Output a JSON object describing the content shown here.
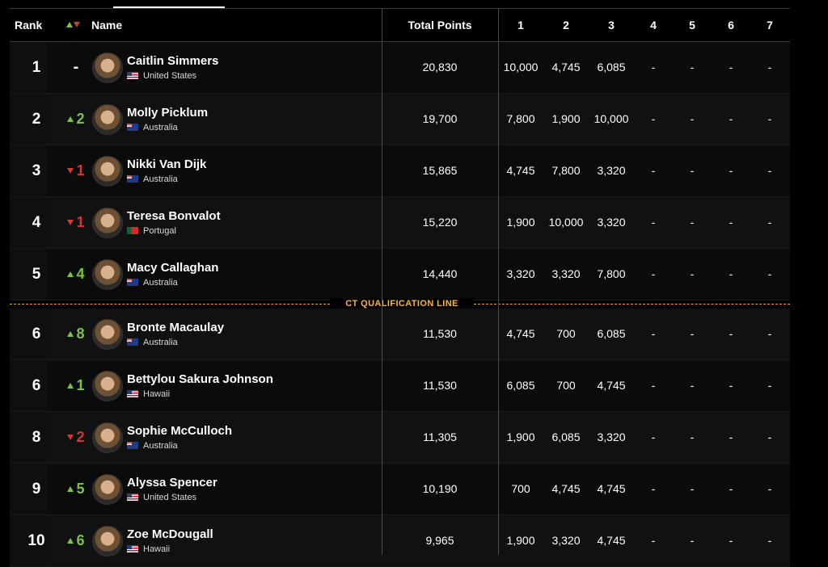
{
  "header": {
    "rank": "Rank",
    "name": "Name",
    "total": "Total Points",
    "events": [
      "1",
      "2",
      "3",
      "4",
      "5",
      "6",
      "7"
    ]
  },
  "qualification_line": "CT QUALIFICATION LINE",
  "colors": {
    "up": "#7fc241",
    "down": "#cf3a32",
    "qualification": "#f3b73e"
  },
  "rows": [
    {
      "rank": "1",
      "move": "-",
      "dir": "none",
      "name": "Caitlin Simmers",
      "country": "United States",
      "flag": "us",
      "total": "20,830",
      "events": [
        "10,000",
        "4,745",
        "6,085",
        "-",
        "-",
        "-",
        "-"
      ]
    },
    {
      "rank": "2",
      "move": "2",
      "dir": "up",
      "name": "Molly Picklum",
      "country": "Australia",
      "flag": "au",
      "total": "19,700",
      "events": [
        "7,800",
        "1,900",
        "10,000",
        "-",
        "-",
        "-",
        "-"
      ]
    },
    {
      "rank": "3",
      "move": "1",
      "dir": "down",
      "name": "Nikki Van Dijk",
      "country": "Australia",
      "flag": "au",
      "total": "15,865",
      "events": [
        "4,745",
        "7,800",
        "3,320",
        "-",
        "-",
        "-",
        "-"
      ]
    },
    {
      "rank": "4",
      "move": "1",
      "dir": "down",
      "name": "Teresa Bonvalot",
      "country": "Portugal",
      "flag": "pt",
      "total": "15,220",
      "events": [
        "1,900",
        "10,000",
        "3,320",
        "-",
        "-",
        "-",
        "-"
      ]
    },
    {
      "rank": "5",
      "move": "4",
      "dir": "up",
      "name": "Macy Callaghan",
      "country": "Australia",
      "flag": "au",
      "total": "14,440",
      "events": [
        "3,320",
        "3,320",
        "7,800",
        "-",
        "-",
        "-",
        "-"
      ]
    },
    {
      "rank": "6",
      "move": "8",
      "dir": "up",
      "name": "Bronte Macaulay",
      "country": "Australia",
      "flag": "au",
      "total": "11,530",
      "events": [
        "4,745",
        "700",
        "6,085",
        "-",
        "-",
        "-",
        "-"
      ]
    },
    {
      "rank": "6",
      "move": "1",
      "dir": "up",
      "name": "Bettylou Sakura Johnson",
      "country": "Hawaii",
      "flag": "hi",
      "total": "11,530",
      "events": [
        "6,085",
        "700",
        "4,745",
        "-",
        "-",
        "-",
        "-"
      ]
    },
    {
      "rank": "8",
      "move": "2",
      "dir": "down",
      "name": "Sophie McCulloch",
      "country": "Australia",
      "flag": "au",
      "total": "11,305",
      "events": [
        "1,900",
        "6,085",
        "3,320",
        "-",
        "-",
        "-",
        "-"
      ]
    },
    {
      "rank": "9",
      "move": "5",
      "dir": "up",
      "name": "Alyssa Spencer",
      "country": "United States",
      "flag": "us",
      "total": "10,190",
      "events": [
        "700",
        "4,745",
        "4,745",
        "-",
        "-",
        "-",
        "-"
      ]
    },
    {
      "rank": "10",
      "move": "6",
      "dir": "up",
      "name": "Zoe McDougall",
      "country": "Hawaii",
      "flag": "hi",
      "total": "9,965",
      "events": [
        "1,900",
        "3,320",
        "4,745",
        "-",
        "-",
        "-",
        "-"
      ]
    }
  ]
}
